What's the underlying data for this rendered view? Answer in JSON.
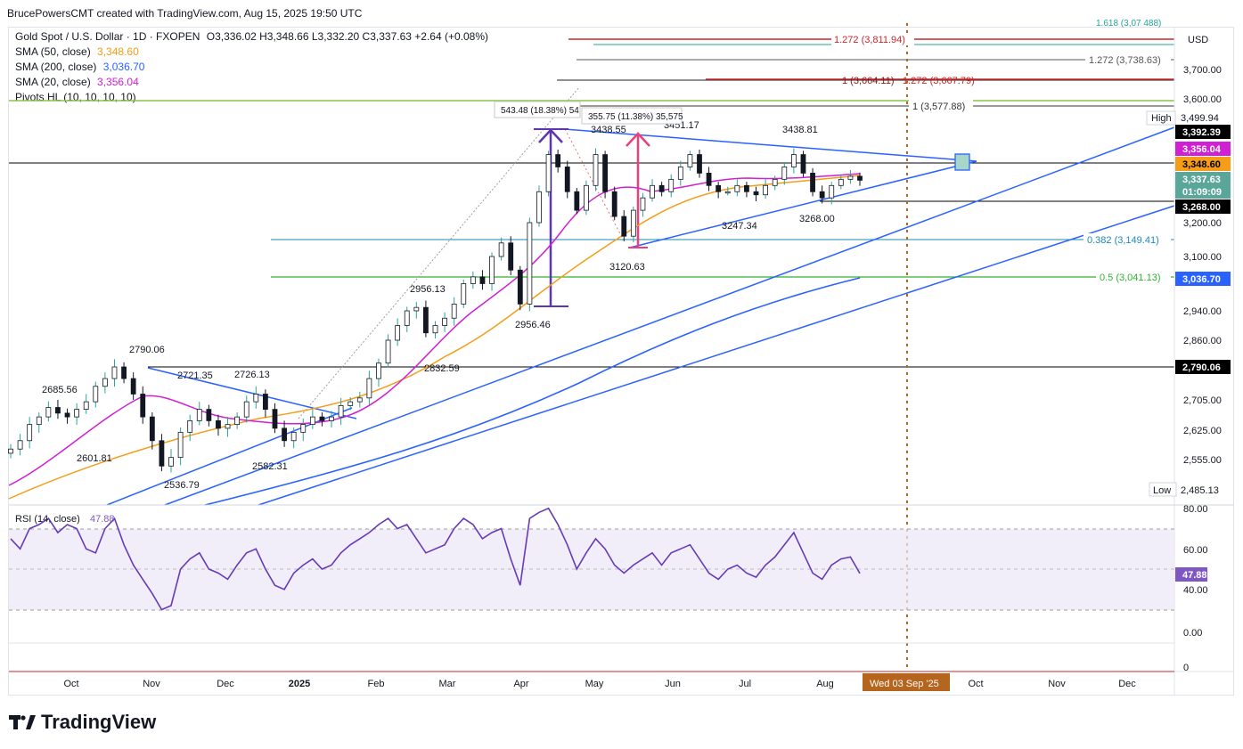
{
  "header": {
    "attribution": "BrucePowersCMT created with TradingView.com, Aug 15, 2025 19:50 UTC"
  },
  "symbol": {
    "title": "Gold Spot / U.S. Dollar · 1D · FXOPEN",
    "ohlc": "O3,336.02  H3,348.66  L3,332.20  C3,337.63  +2.64 (+0.08%)",
    "indicators": [
      {
        "name": "SMA (50, close)",
        "value": "3,348.60",
        "color": "#f59d18"
      },
      {
        "name": "SMA (200, close)",
        "value": "3,036.70",
        "color": "#2962ff"
      },
      {
        "name": "SMA (20, close)",
        "value": "3,356.04",
        "color": "#d120d4"
      },
      {
        "name": "Pivots HL (10, 10, 10, 10)",
        "value": "",
        "color": "#131722"
      }
    ]
  },
  "price_axis": {
    "currency": "USD",
    "ticks": [
      "3,700.00",
      "3,600.00",
      "3,200.00",
      "3,100.00",
      "2,940.00",
      "2,860.00",
      "2,705.00",
      "2,625.00",
      "2,555.00"
    ],
    "high_label": "High",
    "high_value": "3,499.94",
    "low_label": "Low",
    "low_value": "2,485.13",
    "tags": [
      {
        "value": "3,392.39",
        "bg": "#000000",
        "fg": "#ffffff"
      },
      {
        "value": "3,356.04",
        "bg": "#d120d4",
        "fg": "#ffffff"
      },
      {
        "value": "3,348.60",
        "bg": "#f59d18",
        "fg": "#000000"
      },
      {
        "value": "3,337.63",
        "bg": "#5aa69a",
        "fg": "#ffffff"
      },
      {
        "value": "01:09:09",
        "bg": "#5aa69a",
        "fg": "#ffffff"
      },
      {
        "value": "3,268.00",
        "bg": "#000000",
        "fg": "#ffffff"
      },
      {
        "value": "3,036.70",
        "bg": "#2962ff",
        "fg": "#ffffff"
      },
      {
        "value": "2,790.06",
        "bg": "#000000",
        "fg": "#ffffff"
      }
    ]
  },
  "rsi": {
    "label": "RSI (14, close)",
    "value": "47.88",
    "ticks": [
      "80.00",
      "60.00",
      "40.00",
      "0.00",
      "0"
    ],
    "tag": "47.88",
    "tag_color": "#7e57c2"
  },
  "time_axis": {
    "labels": [
      "Oct",
      "Nov",
      "Dec",
      "2025",
      "Feb",
      "Mar",
      "Apr",
      "May",
      "Jun",
      "Jul",
      "Aug",
      "Oct",
      "Nov",
      "Dec"
    ],
    "cursor_label": "Wed 03 Sep '25"
  },
  "annotations": {
    "pivots": [
      "2790.06",
      "2685.56",
      "2721.35",
      "2726.13",
      "2601.81",
      "2536.79",
      "2582.31",
      "2956.13",
      "2956.46",
      "2832.59",
      "3438.55",
      "3451.17",
      "3438.81",
      "3247.34",
      "3268.00",
      "3120.63"
    ],
    "measure_1": "543.48 (18.38%) 54",
    "measure_2": "355.75 (11.38%) 35,575",
    "fib_levels": [
      {
        "label": "1.272 (3,811.94)",
        "color": "#c62828"
      },
      {
        "label": "1.272 (3,738.63)",
        "color": "#555555"
      },
      {
        "label": "1 (3,664.11)",
        "color": "#8b1a1a"
      },
      {
        "label": "1.272 (3,667.79)",
        "color": "#c62828"
      },
      {
        "label": "1 (3,577.88)",
        "color": "#333333"
      },
      {
        "label": "0.382 (3,149.41)",
        "color": "#1e88b6"
      },
      {
        "label": "0.5 (3,041.13)",
        "color": "#2fb52f"
      }
    ],
    "top_cut": "1.618 (3,07 488)"
  },
  "brand": {
    "name": "TradingView"
  },
  "chart_data": {
    "type": "candlestick",
    "title": "Gold Spot / U.S. Dollar · 1D · FXOPEN",
    "xlabel": "",
    "ylabel": "USD",
    "ylim": [
      2450,
      3790
    ],
    "x_labels": [
      "Oct",
      "Nov",
      "Dec",
      "2025",
      "Feb",
      "Mar",
      "Apr",
      "May",
      "Jun",
      "Jul",
      "Aug",
      "Oct",
      "Nov",
      "Dec"
    ],
    "series": [
      {
        "name": "SMA (20, close)",
        "last": 3356.04
      },
      {
        "name": "SMA (50, close)",
        "last": 3348.6
      },
      {
        "name": "SMA (200, close)",
        "last": 3036.7
      }
    ],
    "close_path": [
      2580,
      2600,
      2640,
      2660,
      2685,
      2670,
      2660,
      2680,
      2700,
      2740,
      2760,
      2790,
      2760,
      2720,
      2660,
      2600,
      2540,
      2560,
      2620,
      2650,
      2680,
      2650,
      2630,
      2640,
      2660,
      2700,
      2720,
      2680,
      2630,
      2600,
      2620,
      2640,
      2660,
      2650,
      2660,
      2690,
      2700,
      2710,
      2760,
      2800,
      2860,
      2900,
      2940,
      2950,
      2880,
      2900,
      2920,
      2960,
      3020,
      3040,
      3020,
      3100,
      3140,
      3060,
      2960,
      3200,
      3300,
      3420,
      3380,
      3300,
      3240,
      3320,
      3420,
      3300,
      3220,
      3160,
      3240,
      3280,
      3320,
      3300,
      3340,
      3380,
      3420,
      3360,
      3320,
      3300,
      3300,
      3320,
      3300,
      3290,
      3320,
      3340,
      3380,
      3420,
      3360,
      3300,
      3280,
      3320,
      3340,
      3350,
      3337
    ],
    "rsi_path": [
      65,
      60,
      70,
      72,
      75,
      68,
      72,
      70,
      60,
      58,
      70,
      75,
      62,
      52,
      45,
      38,
      30,
      32,
      50,
      55,
      58,
      50,
      48,
      45,
      52,
      58,
      60,
      50,
      42,
      40,
      48,
      52,
      55,
      50,
      52,
      58,
      62,
      65,
      68,
      72,
      75,
      70,
      72,
      65,
      58,
      60,
      62,
      70,
      75,
      72,
      65,
      68,
      70,
      55,
      42,
      75,
      78,
      80,
      72,
      62,
      50,
      58,
      65,
      60,
      52,
      48,
      52,
      55,
      58,
      52,
      58,
      60,
      62,
      55,
      48,
      45,
      50,
      52,
      48,
      46,
      52,
      56,
      62,
      68,
      58,
      48,
      45,
      52,
      55,
      56,
      47.88
    ]
  }
}
